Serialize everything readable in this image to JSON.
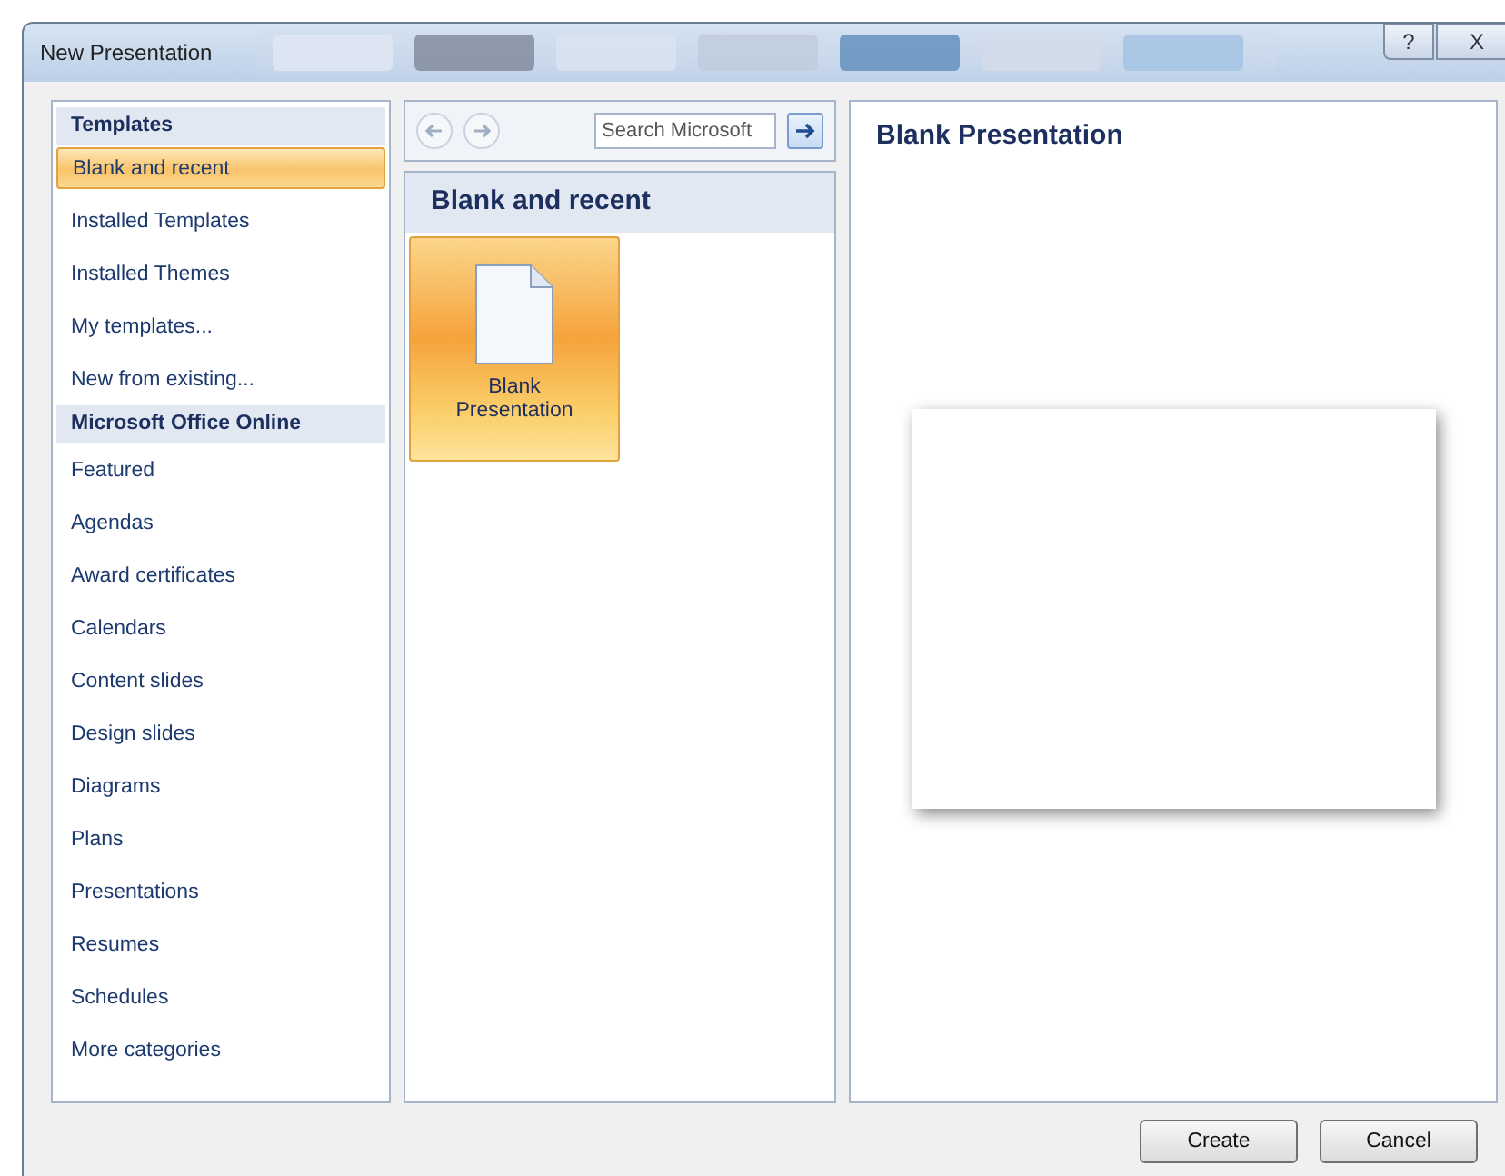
{
  "window": {
    "title": "New Presentation",
    "help_button": "?",
    "close_button": "X"
  },
  "sidebar": {
    "items": [
      {
        "kind": "header",
        "label": "Templates"
      },
      {
        "kind": "item",
        "label": "Blank and recent",
        "selected": true
      },
      {
        "kind": "item",
        "label": "Installed Templates",
        "selected": false
      },
      {
        "kind": "item",
        "label": "Installed Themes",
        "selected": false
      },
      {
        "kind": "item",
        "label": "My templates...",
        "selected": false
      },
      {
        "kind": "item",
        "label": "New from existing...",
        "selected": false
      },
      {
        "kind": "header",
        "label": "Microsoft Office Online"
      },
      {
        "kind": "item",
        "label": "Featured",
        "selected": false
      },
      {
        "kind": "item",
        "label": "Agendas",
        "selected": false
      },
      {
        "kind": "item",
        "label": "Award certificates",
        "selected": false
      },
      {
        "kind": "item",
        "label": "Calendars",
        "selected": false
      },
      {
        "kind": "item",
        "label": "Content slides",
        "selected": false
      },
      {
        "kind": "item",
        "label": "Design slides",
        "selected": false
      },
      {
        "kind": "item",
        "label": "Diagrams",
        "selected": false
      },
      {
        "kind": "item",
        "label": "Plans",
        "selected": false
      },
      {
        "kind": "item",
        "label": "Presentations",
        "selected": false
      },
      {
        "kind": "item",
        "label": "Resumes",
        "selected": false
      },
      {
        "kind": "item",
        "label": "Schedules",
        "selected": false
      },
      {
        "kind": "item",
        "label": "More categories",
        "selected": false
      }
    ]
  },
  "toolbar": {
    "search": {
      "placeholder": "Search Microsoft"
    }
  },
  "gallery": {
    "title": "Blank and recent",
    "items": [
      {
        "label": "Blank Presentation",
        "selected": true
      }
    ]
  },
  "preview": {
    "title": "Blank Presentation"
  },
  "buttons": [
    "Create",
    "Cancel"
  ]
}
